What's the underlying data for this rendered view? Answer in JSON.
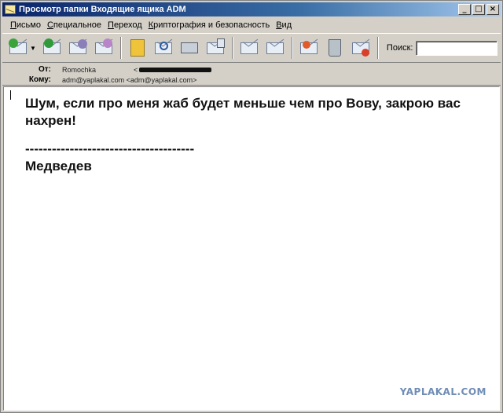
{
  "window": {
    "title": "Просмотр папки Входящие ящика ADM",
    "controls": {
      "minimize": "_",
      "maximize": "□",
      "close": "×"
    }
  },
  "menu": {
    "items": [
      "Письмо",
      "Специальное",
      "Переход",
      "Криптография и безопасность",
      "Вид"
    ]
  },
  "toolbar": {
    "search_label": "Поиск:",
    "search_value": "",
    "icons": [
      "get-mail-icon",
      "forward-icon",
      "reply-icon",
      "new-mail-icon",
      "address-book-icon",
      "find-icon",
      "print-icon",
      "view-icon",
      "prev-icon",
      "next-icon",
      "mark-icon",
      "delete-icon",
      "spam-icon"
    ]
  },
  "header": {
    "from_label": "От:",
    "from_value": "Romochka",
    "from_bracket": "<",
    "to_label": "Кому:",
    "to_value": "adm@yaplakal.com <adm@yaplakal.com>"
  },
  "message": {
    "line1": "Шум, если про меня жаб будет меньше чем про Вову, закрою вас нахрен!",
    "dashes": "--------------------------------------",
    "signature": "Медведев"
  },
  "watermark": "YAPLAKAL.COM",
  "colors": {
    "titlebar_start": "#0a246a",
    "window_bg": "#d4d0c8",
    "watermark": "#6f8db5"
  }
}
